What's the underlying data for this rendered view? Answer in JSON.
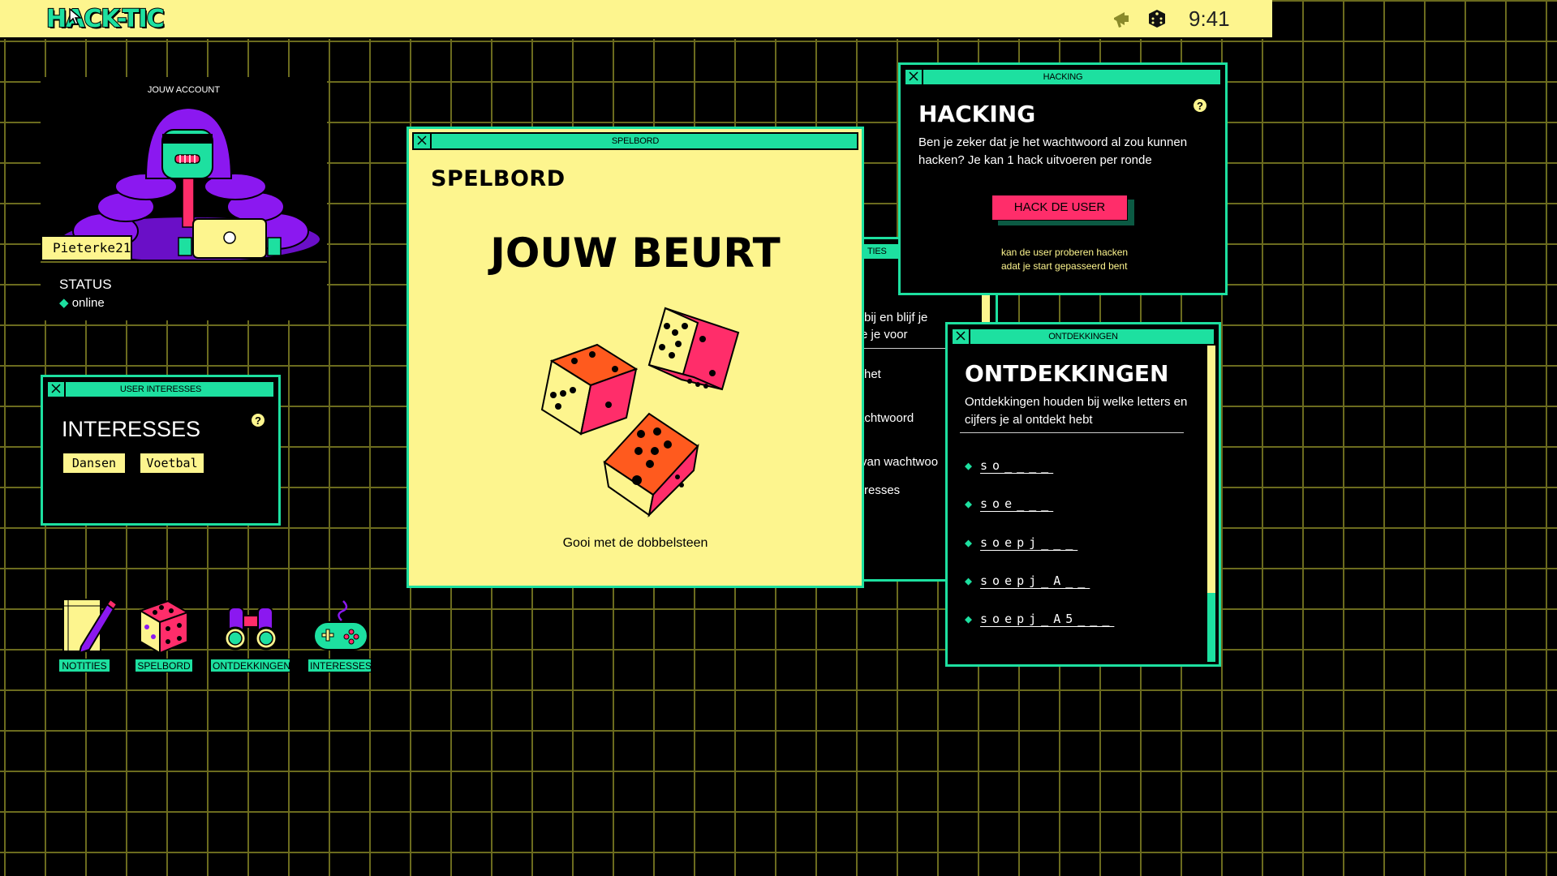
{
  "topbar": {
    "logo": "HACK-TIC",
    "time": "9:41",
    "icons": [
      "megaphone-icon",
      "dice-icon"
    ]
  },
  "account": {
    "title": "JOUW ACCOUNT",
    "username": "Pieterke21",
    "status_label": "STATUS",
    "status_value": "online"
  },
  "interests_window": {
    "title": "USER INTERESSES",
    "heading": "INTERESSES",
    "tags": [
      "Dansen",
      "Voetbal"
    ],
    "help": "?"
  },
  "desktop_icons": [
    {
      "label": "NOTITIES",
      "icon": "notebook-icon"
    },
    {
      "label": "SPELBORD",
      "icon": "dice-icon"
    },
    {
      "label": "ONTDEKKINGEN",
      "icon": "binoculars-icon"
    },
    {
      "label": "INTERESSES",
      "icon": "gamepad-icon"
    }
  ],
  "spelbord": {
    "title": "SPELBORD",
    "heading": "SPELBORD",
    "turn": "JOUW BEURT",
    "instruction": "Gooi met de dobbelsteen"
  },
  "notities": {
    "title_fragment": "TIES",
    "lines": [
      "bij en blijf je",
      "e je voor",
      "het",
      "achtwoord",
      "van wachtwoo",
      "resses"
    ]
  },
  "hacking": {
    "title": "HACKING",
    "heading": "HACKING",
    "description": "Ben je zeker dat je het wachtwoord al zou kunnen hacken? Je kan 1 hack uitvoeren per ronde",
    "button": "HACK DE USER",
    "note_line1": "kan de user proberen hacken",
    "note_line2": "adat je start gepasseerd bent",
    "help": "?"
  },
  "ontdekkingen": {
    "title": "ONTDEKKINGEN",
    "heading": "ONTDEKKINGEN",
    "description": "Ontdekkingen houden bij welke letters en cijfers je al ontdekt hebt",
    "items": [
      "so____",
      "soe___",
      "soepj___",
      "soepj_A__",
      "soepj_A5___"
    ]
  },
  "colors": {
    "accent": "#1de0a0",
    "yellow": "#fdf58e",
    "pink": "#ff2d6a",
    "purple": "#8b18f0",
    "grid": "#6b6b1e"
  }
}
